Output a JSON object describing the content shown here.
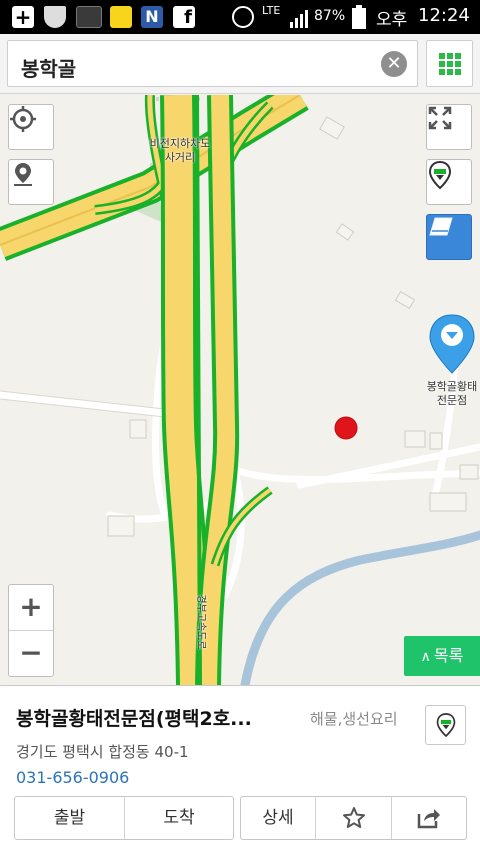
{
  "status_bar": {
    "icons": [
      "plus-box-icon",
      "shield-icon",
      "band-icon",
      "kakao-talk-icon",
      "naver-icon",
      "facebook-icon",
      "alarm-icon"
    ],
    "network": "LTE",
    "battery": "87%",
    "ampm": "오후",
    "time": "12:24"
  },
  "search": {
    "query": "봉학골"
  },
  "map": {
    "intersection_label_line1": "비전지하차도",
    "intersection_label_line2": "사거리",
    "poi_label_line1": "봉학골황태",
    "poi_label_line2": "전문점",
    "road_label": "경부고속도로",
    "list_button_label": "목록",
    "zoom_in": "+",
    "zoom_out": "−"
  },
  "place": {
    "name": "봉학골황태전문점(평택2호...",
    "category": "해물,생선요리",
    "address": "경기도 평택시 합정동 40-1",
    "phone": "031-656-0906"
  },
  "actions": {
    "depart": "출발",
    "arrive": "도착",
    "detail": "상세"
  },
  "colors": {
    "accent_green": "#1fc36a",
    "traffic_green": "#19b02a",
    "road_yellow": "#f7d66b",
    "pin_blue": "#3ba0e8",
    "link_blue": "#2a74b8"
  }
}
